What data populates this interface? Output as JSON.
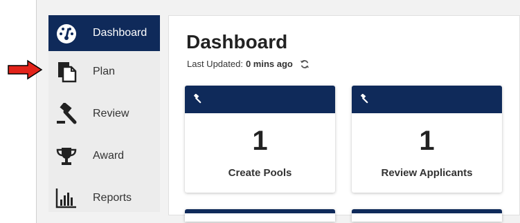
{
  "sidebar": {
    "items": [
      {
        "label": "Dashboard",
        "icon": "dashboard-gauge-icon",
        "active": true
      },
      {
        "label": "Plan",
        "icon": "copy-document-icon",
        "active": false
      },
      {
        "label": "Review",
        "icon": "gavel-icon",
        "active": false
      },
      {
        "label": "Award",
        "icon": "trophy-icon",
        "active": false
      },
      {
        "label": "Reports",
        "icon": "bar-chart-icon",
        "active": false
      }
    ]
  },
  "main": {
    "title": "Dashboard",
    "updated_label": "Last Updated:",
    "updated_value": "0 mins ago"
  },
  "cards": [
    {
      "count": "1",
      "caption": "Create Pools",
      "icon": "gavel-icon"
    },
    {
      "count": "1",
      "caption": "Review Applicants",
      "icon": "gavel-icon"
    }
  ],
  "colors": {
    "navy": "#0f2a5a",
    "arrow": "#e2231a"
  }
}
